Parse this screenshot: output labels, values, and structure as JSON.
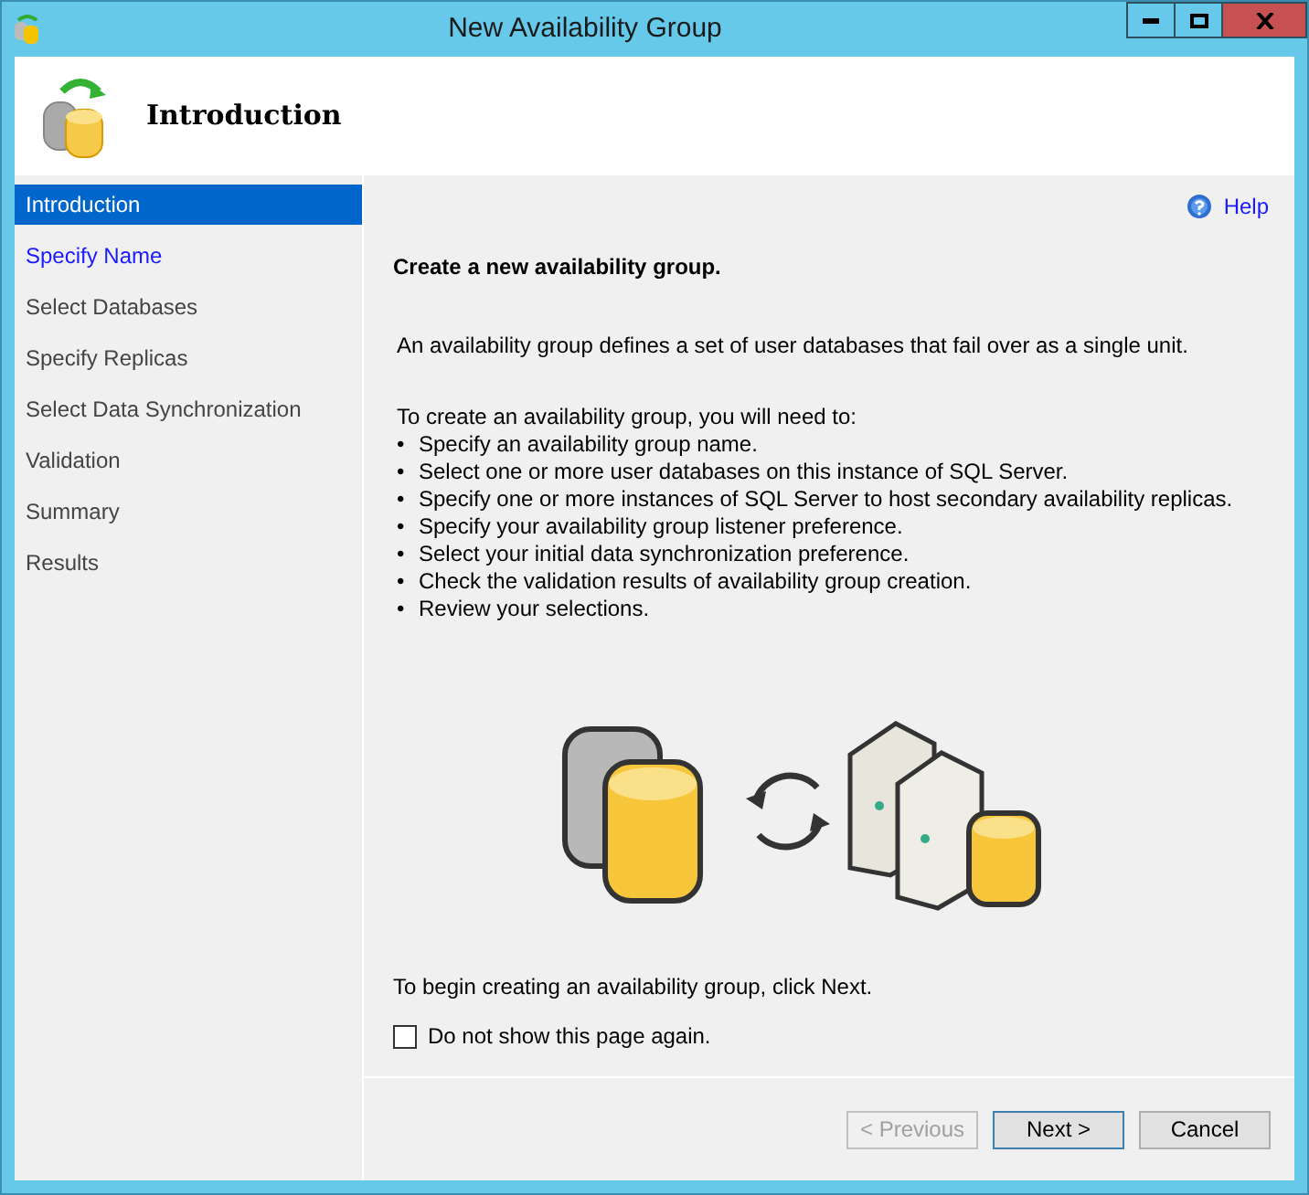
{
  "window": {
    "title": "New Availability Group"
  },
  "header": {
    "title": "Introduction"
  },
  "sidebar": {
    "items": [
      {
        "label": "Introduction",
        "selected": true,
        "available": true
      },
      {
        "label": "Specify Name",
        "selected": false,
        "available": true
      },
      {
        "label": "Select Databases",
        "selected": false,
        "available": false
      },
      {
        "label": "Specify Replicas",
        "selected": false,
        "available": false
      },
      {
        "label": "Select Data Synchronization",
        "selected": false,
        "available": false
      },
      {
        "label": "Validation",
        "selected": false,
        "available": false
      },
      {
        "label": "Summary",
        "selected": false,
        "available": false
      },
      {
        "label": "Results",
        "selected": false,
        "available": false
      }
    ]
  },
  "help": {
    "label": "Help"
  },
  "content": {
    "heading": "Create a new availability group.",
    "description": "An availability group defines a set of user databases that fail over as a single unit.",
    "steps_intro": "To create an availability group, you will need to:",
    "steps": [
      {
        "bullet": "•",
        "text": "Specify an availability group name."
      },
      {
        "bullet": "•",
        "text": "Select one or more user databases on this instance of SQL Server."
      },
      {
        "bullet": "•",
        "text": "Specify one or more instances of SQL Server to host secondary availability replicas."
      },
      {
        "bullet": "•",
        "text": "Specify your availability group listener preference."
      },
      {
        "bullet": "•",
        "text": "Select your initial data synchronization preference."
      },
      {
        "bullet": "•",
        "text": "Check the validation results of availability group creation."
      },
      {
        "bullet": "•",
        "text": "Review your selections."
      }
    ],
    "begin_hint": "To begin creating an availability group, click Next.",
    "dont_show": {
      "label": "Do not show this page again.",
      "checked": false
    }
  },
  "buttons": [
    {
      "label": "< Previous",
      "disabled": true,
      "default": false
    },
    {
      "label": "Next >",
      "disabled": false,
      "default": true
    },
    {
      "label": "Cancel",
      "disabled": false,
      "default": false
    }
  ]
}
